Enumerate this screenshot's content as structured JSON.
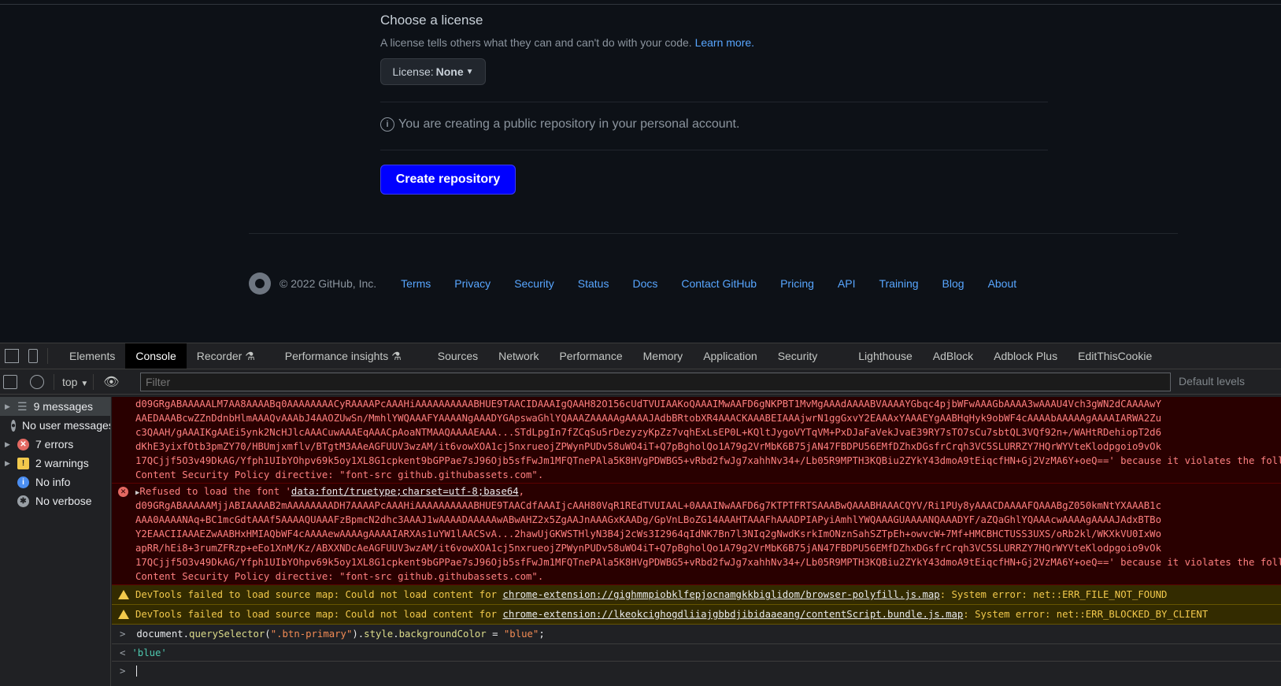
{
  "github": {
    "license_title": "Choose a license",
    "license_desc": "A license tells others what they can and can't do with your code.",
    "learn_more": "Learn more.",
    "license_label": "License:",
    "license_value": "None",
    "notice": "You are creating a public repository in your personal account.",
    "create_button": "Create repository",
    "create_button_color": "#0000ff",
    "copyright": "© 2022 GitHub, Inc.",
    "footer_links": [
      "Terms",
      "Privacy",
      "Security",
      "Status",
      "Docs",
      "Contact GitHub",
      "Pricing",
      "API",
      "Training",
      "Blog",
      "About"
    ]
  },
  "devtools": {
    "tabs": [
      "Elements",
      "Console",
      "Recorder",
      "Performance insights",
      "Sources",
      "Network",
      "Performance",
      "Memory",
      "Application",
      "Security",
      "Lighthouse",
      "AdBlock",
      "Adblock Plus",
      "EditThisCookie"
    ],
    "context": "top",
    "filter_placeholder": "Filter",
    "default_levels": "Default levels",
    "sidebar": [
      {
        "label": "9 messages",
        "icon": "list-icon"
      },
      {
        "label": "No user messages",
        "icon": "user-icon"
      },
      {
        "label": "7 errors",
        "icon": "error-icon"
      },
      {
        "label": "2 warnings",
        "icon": "warning-icon"
      },
      {
        "label": "No info",
        "icon": "info-icon"
      },
      {
        "label": "No verbose",
        "icon": "bug-icon"
      }
    ],
    "error1_lines": [
      "d09GRgABAAAAALM7AA8AAAABq0AAAAAAAACyRAAAAPcAAAHiAAAAAAAAAABHUE9TAACIDAAAIgQAAH82O156cUdTVUIAAKoQAAAIMwAAFD6gNKPBT1MvMgAAAdAAAABVAAAAYGbqc4pjbWFwAAAGbAAAA3wAAAU4Vch3gWN2dCAAAAwY",
      "AAEDAAABcwZZnDdnbHlmAAAQvAAAbJ4AAOZUwSn/MmhlYWQAAAFYAAAANgAAADYGApswaGhlYQAAAZAAAAAgAAAAJAdbBRtobXR4AAACKAAABEIAAAjwrN1ggGxvY2EAAAxYAAAEYgAABHqHyk9obWF4cAAAAbAAAAAgAAAAIARWA2Zu",
      "c3QAAH/gAAAIKgAAEi5ynk2NcHJlcAAACuwAAAEqAAACpAoaNTMAAQAAAAEAAA...STdLpgIn7fZCqSu5rDezyzyKpZz7vqhExLsEP0L+KQltJygoVYTqVM+PxDJaFaVekJvaE39RY7sTO7sCu7sbtQL3VQf92n+/WAHtRDehiopT2d6",
      "dKhE3yixfOtb3pmZY70/HBUmjxmflv/BTgtM3AAeAGFUUV3wzAM/it6vowXOA1cj5nxrueojZPWynPUDv58uWO4iT+Q7pBgholQo1A79g2VrMbK6B75jAN47FBDPU56EMfDZhxDGsfrCrqh3VC5SLURRZY7HQrWYVteKlodpgoio9vOk",
      "17QCjjf5O3v49DkAG/Yfph1UIbYOhpv69k5oy1XL8G1cpkent9bGPPae7sJ96Ojb5sfFwJm1MFQTnePAla5K8HVgPDWBG5+vRbd2fwJg7xahhNv34+/Lb05R9MPTH3KQBiu2ZYkY43dmoA9tEiqcfHN+Gj2VzMA6Y+oeQ==' because it violates the following",
      "Content Security Policy directive: \"font-src github.githubassets.com\"."
    ],
    "error2_prefix": "Refused to load the font '",
    "error2_link": "data:font/truetype;charset=utf-8;base64",
    "error2_lines": [
      "d09GRgABAAAAAMjjABIAAAAB2mAAAAAAAADH7AAAAPcAAAHiAAAAAAAAAABHUE9TAACdfAAAIjcAAH80VqR1REdTVUIAAL+0AAAINwAAFD6g7KTPTFRTSAAABwQAAABHAAACQYV/Ri1PUy8yAAACDAAAAFQAAABgZ050kmNtYXAAAB1c",
      "AAA0AAAANAq+BC1mcGdtAAAf5AAAAQUAAAFzBpmcN2dhc3AAAJ1wAAAADAAAAAwABwAHZ2x5ZgAAJnAAAGxKAADg/GpVnLBoZG14AAAHTAAAFhAAADPIAPyiAmhlYWQAAAGUAAAANQAAADYF/aZQaGhlYQAAAcwAAAAgAAAAJAdxBTBo",
      "Y2EAACIIAAAEZwAABHxHMIAQbWF4cAAAAewAAAAgAAAAIARXAs1uYW1lAACSvA...2hawUjGKWSTHlyN3B4j2cWs3I2964qIdNK7Bn7l3NIq2gNwdKsrkImONznSahSZTpEh+owvcW+7Mf+HMCBHCTUSS3UXS/oRb2kl/WKXkVU0IxWo",
      "apRR/hEi8+3rumZFRzp+eEo1XnM/Kz/ABXXNDcAeAGFUUV3wzAM/it6vowXOA1cj5nxrueojZPWynPUDv58uWO4iT+Q7pBgholQo1A79g2VrMbK6B75jAN47FBDPU56EMfDZhxDGsfrCrqh3VC5SLURRZY7HQrWYVteKlodpgoio9vOk",
      "17QCjjf5O3v49DkAG/Yfph1UIbYOhpv69k5oy1XL8G1cpkent9bGPPae7sJ96Ojb5sfFwJm1MFQTnePAla5K8HVgPDWBG5+vRbd2fwJg7xahhNv34+/Lb05R9MPTH3KQBiu2ZYkY43dmoA9tEiqcfHN+Gj2VzMA6Y+oeQ==' because it violates the following",
      "Content Security Policy directive: \"font-src github.githubassets.com\"."
    ],
    "warnings": [
      {
        "prefix": "DevTools failed to load source map: Could not load content for ",
        "link": "chrome-extension://gighmmpiobklfepjocnamgkkbiglidom/browser-polyfill.js.map",
        "suffix": ": System error: net::ERR_FILE_NOT_FOUND"
      },
      {
        "prefix": "DevTools failed to load source map: Could not load content for ",
        "link": "chrome-extension://lkeokcighogdliiajgbbdjibidaaeang/contentScript.bundle.js.map",
        "suffix": ": System error: net::ERR_BLOCKED_BY_CLIENT"
      }
    ],
    "input": {
      "obj": "document",
      "m1": "querySelector",
      "a1": "\".btn-primary\"",
      "p1": "style",
      "p2": "backgroundColor",
      "op": " = ",
      "val": "\"blue\"",
      "end": ";"
    },
    "result": "'blue'"
  }
}
